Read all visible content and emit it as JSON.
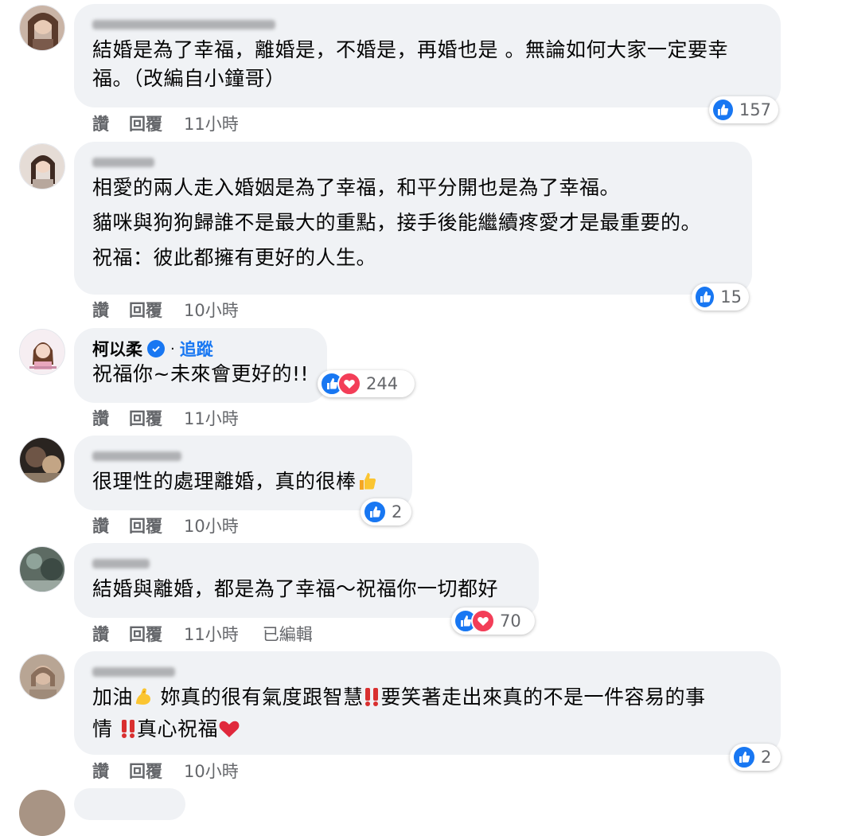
{
  "labels": {
    "like": "讚",
    "reply": "回覆"
  },
  "comments": [
    {
      "name": "Lee Min Chin Filling",
      "lines": [
        "結婚是為了幸福，離婚是，不婚是，再婚也是 。無論如何大家一定要幸",
        "福。（改編自小鐘哥）"
      ],
      "time": "11小時",
      "reaction_count": "157",
      "reactions": [
        "like"
      ]
    },
    {
      "name": "Holli Li",
      "lines": [
        "相愛的兩人走入婚姻是為了幸福，和平分開也是為了幸福。",
        "貓咪與狗狗歸誰不是最大的重點，接手後能繼續疼愛才是最重要的。",
        "祝福：彼此都擁有更好的人生。"
      ],
      "time": "10小時",
      "reaction_count": "15",
      "reactions": [
        "like"
      ]
    },
    {
      "name": "柯以柔",
      "verified": true,
      "dot": "·",
      "follow_label": "追蹤",
      "lines": [
        "祝福你~未來會更好的!!"
      ],
      "time": "11小時",
      "reaction_count": "244",
      "reactions": [
        "like",
        "love"
      ]
    },
    {
      "name": "Chen Di Li",
      "lines": [
        "很理性的處理離婚，真的很棒"
      ],
      "line_suffix_emoji": "thumbs-up-emoji",
      "time": "10小時",
      "reaction_count": "2",
      "reactions": [
        "like"
      ]
    },
    {
      "name": "Hsu Wei",
      "lines": [
        "結婚與離婚，都是為了幸福～祝福你一切都好"
      ],
      "time": "11小時",
      "edited": "已編輯",
      "reaction_count": "70",
      "reactions": [
        "like",
        "love"
      ]
    },
    {
      "name": "Apple Lai",
      "segments": {
        "l1a": "加油",
        "l1b": " 妳真的很有氣度跟智慧",
        "l1c": "要笑著走出來真的不是一件容易的事",
        "l2a": "情 ",
        "l2b": "真心祝福"
      },
      "emojis": [
        "flexed-biceps-emoji",
        "double-exclamation-emoji",
        "double-exclamation-emoji",
        "red-heart-emoji"
      ],
      "time": "10小時",
      "reaction_count": "2",
      "reactions": [
        "like"
      ]
    }
  ],
  "colors": {
    "bubble": "#f0f2f5",
    "meta": "#65676b",
    "like_blue": "#1877f2",
    "love_red": "#f33e58"
  }
}
